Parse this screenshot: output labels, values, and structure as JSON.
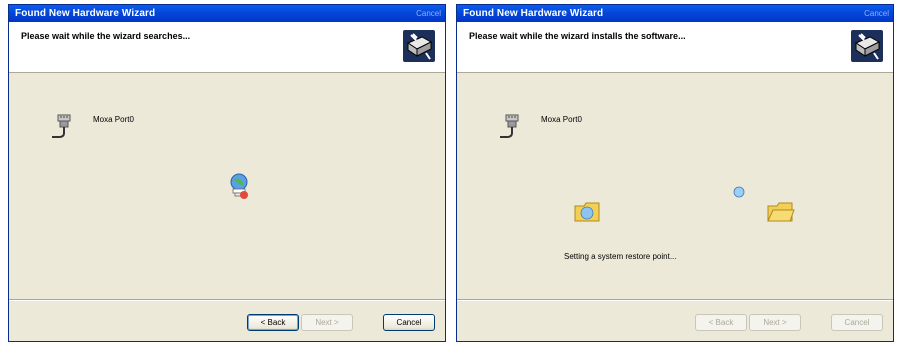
{
  "windows": [
    {
      "title": "Found New Hardware Wizard",
      "close_text": "Cancel",
      "instruction": "Please wait while the wizard searches...",
      "device_name": "Moxa Port0",
      "animation_icon": "globe-search-icon",
      "buttons": {
        "back": "< Back",
        "next": "Next >",
        "cancel": "Cancel"
      }
    },
    {
      "title": "Found New Hardware Wizard",
      "close_text": "Cancel",
      "instruction": "Please wait while the wizard installs the software...",
      "device_name": "Moxa Port0",
      "status": "Setting a system restore point...",
      "animation_icons": [
        "folder-icon",
        "flying-paper-icon",
        "folder-icon"
      ],
      "buttons": {
        "back": "< Back",
        "next": "Next >",
        "cancel": "Cancel"
      }
    }
  ],
  "colors": {
    "title_bar": "#0348d8",
    "window_face": "#ece9d8",
    "header_bg": "#ffffff",
    "button_border": "#003c74",
    "disabled_text": "#aca899"
  }
}
